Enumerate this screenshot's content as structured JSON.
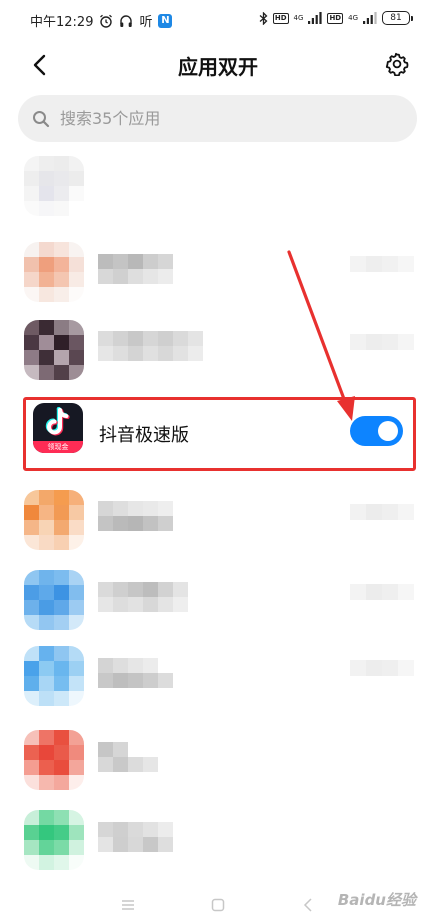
{
  "status_bar": {
    "time": "中午12:29",
    "audio_label": "听",
    "notification_badge": "N",
    "hd_label_1": "HD",
    "hd_label_2": "HD",
    "network_1": "4G",
    "network_2": "4G",
    "battery": "81"
  },
  "header": {
    "title": "应用双开"
  },
  "search": {
    "placeholder": "搜索35个应用"
  },
  "highlighted_app": {
    "name": "抖音极速版",
    "badge": "领现金",
    "dual_enabled": true
  },
  "colors": {
    "accent": "#0d84ff",
    "highlight": "#e8312f",
    "search_bg": "#efefef"
  },
  "watermark": "Baidu经验"
}
